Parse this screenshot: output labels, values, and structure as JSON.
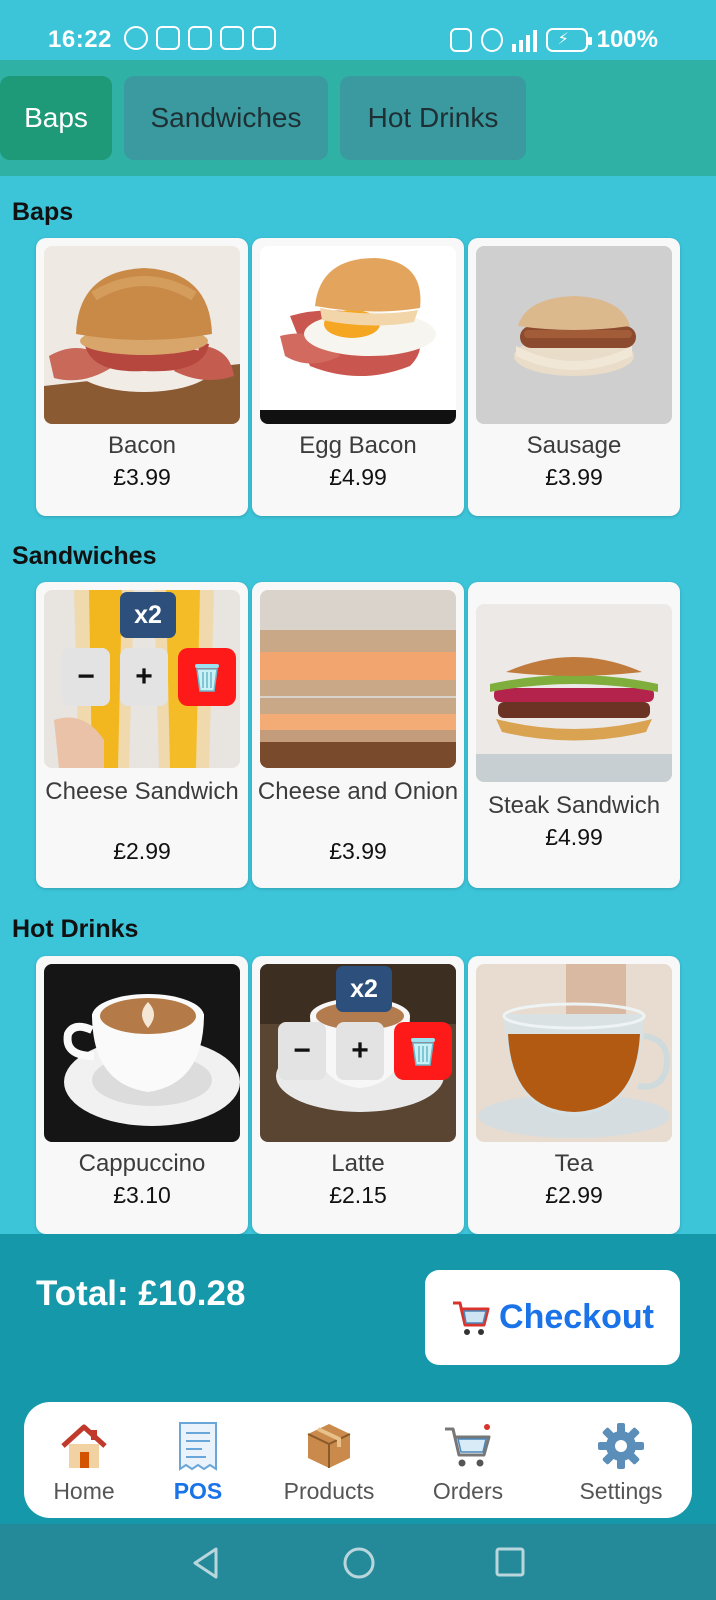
{
  "status_bar": {
    "time": "16:22",
    "battery": "100%"
  },
  "tabs": [
    {
      "label": "Baps",
      "active": true
    },
    {
      "label": "Sandwiches",
      "active": false
    },
    {
      "label": "Hot Drinks",
      "active": false
    }
  ],
  "sections": [
    {
      "title": "Baps",
      "items": [
        {
          "name": "Bacon",
          "price": "£3.99"
        },
        {
          "name": "Egg Bacon",
          "price": "£4.99"
        },
        {
          "name": "Sausage",
          "price": "£3.99"
        }
      ]
    },
    {
      "title": "Sandwiches",
      "items": [
        {
          "name": "Cheese Sandwich",
          "price": "£2.99",
          "quantity": "x2"
        },
        {
          "name": "Cheese and Onion",
          "price": "£3.99"
        },
        {
          "name": "Steak Sandwich",
          "price": "£4.99"
        }
      ]
    },
    {
      "title": "Hot Drinks",
      "items": [
        {
          "name": "Cappuccino",
          "price": "£3.10"
        },
        {
          "name": "Latte",
          "price": "£2.15",
          "quantity": "x2"
        },
        {
          "name": "Tea",
          "price": "£2.99"
        }
      ]
    }
  ],
  "qty_controls": {
    "minus": "−",
    "plus": "+"
  },
  "cart": {
    "total": "Total: £10.28",
    "checkout_label": "Checkout"
  },
  "nav": [
    {
      "label": "Home",
      "icon": "house-icon"
    },
    {
      "label": "POS",
      "icon": "receipt-icon",
      "active": true
    },
    {
      "label": "Products",
      "icon": "package-icon"
    },
    {
      "label": "Orders",
      "icon": "shopping-cart-icon"
    },
    {
      "label": "Settings",
      "icon": "gear-icon"
    }
  ],
  "colors": {
    "background": "#3cc4d9",
    "tab_bar": "#2fb1a5",
    "active_tab": "#1f9a78",
    "checkout_bar": "#1498aa",
    "accent_blue": "#1a73e8",
    "qty_badge": "#2c4f7c",
    "delete_red": "#ff1a1a"
  }
}
